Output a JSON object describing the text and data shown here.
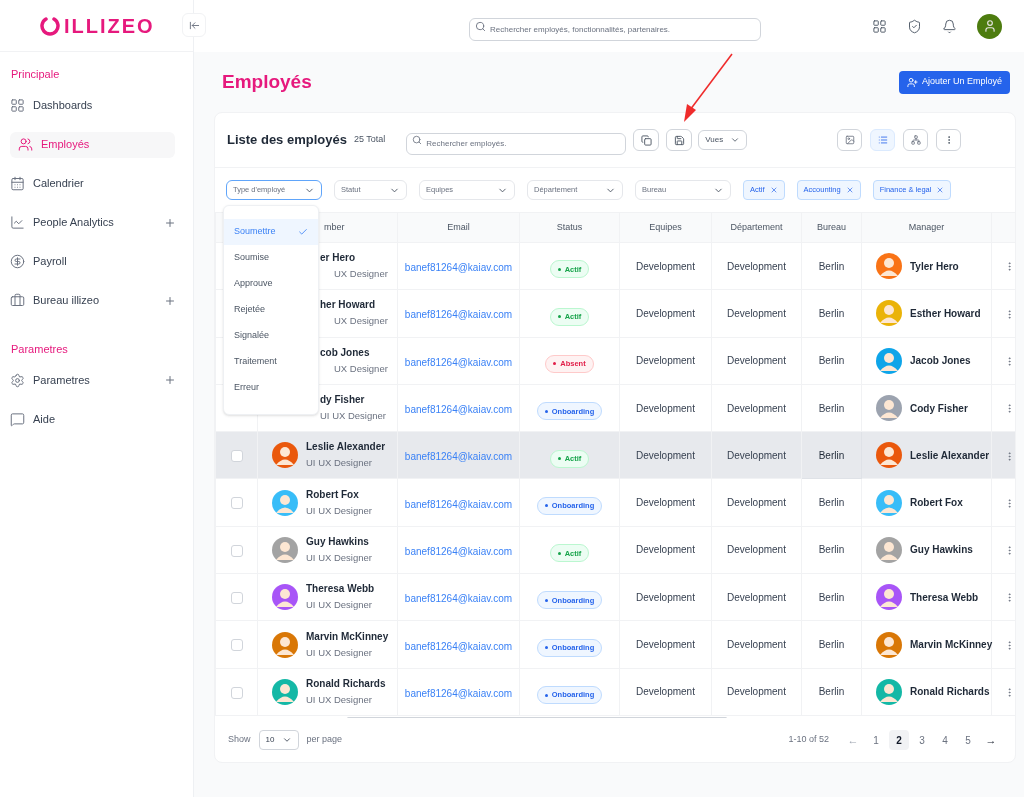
{
  "logo": "ILLIZEO",
  "search": {
    "placeholder": "Rechercher employés, fonctionnalités, partenaires."
  },
  "sidebar": {
    "sections": [
      {
        "title": "Principale",
        "items": [
          {
            "label": "Dashboards",
            "selected": false,
            "expandable": false
          },
          {
            "label": "Employés",
            "selected": true,
            "expandable": false
          },
          {
            "label": "Calendrier",
            "selected": false,
            "expandable": false
          },
          {
            "label": "People Analytics",
            "selected": false,
            "expandable": true
          },
          {
            "label": "Payroll",
            "selected": false,
            "expandable": false
          },
          {
            "label": "Bureau illizeo",
            "selected": false,
            "expandable": true
          }
        ]
      },
      {
        "title": "Parametres",
        "items": [
          {
            "label": "Parametres",
            "selected": false,
            "expandable": true
          },
          {
            "label": "Aide",
            "selected": false,
            "expandable": false
          }
        ]
      }
    ]
  },
  "page_title": "Employés",
  "add_button": "Ajouter Un Employé",
  "list": {
    "title": "Liste des employés",
    "total": "25 Total",
    "search_placeholder": "Rechercher employés.",
    "views": "Vues",
    "view_modes": [
      {
        "selected": false
      },
      {
        "selected": true
      },
      {
        "selected": false
      }
    ]
  },
  "filters": [
    {
      "placeholder": "Type d'employé",
      "open": true
    },
    {
      "placeholder": "Statut",
      "open": false
    },
    {
      "placeholder": "Equipes",
      "open": false
    },
    {
      "placeholder": "Département",
      "open": false
    },
    {
      "placeholder": "Bureau",
      "open": false
    }
  ],
  "chips": [
    "Actif",
    "Accounting",
    "Finance & legal"
  ],
  "dropdown": [
    {
      "label": "Soumettre",
      "selected": true
    },
    {
      "label": "Soumise",
      "selected": false
    },
    {
      "label": "Approuve",
      "selected": false
    },
    {
      "label": "Rejetée",
      "selected": false
    },
    {
      "label": "Signalée",
      "selected": false
    },
    {
      "label": "Traitement",
      "selected": false
    },
    {
      "label": "Erreur",
      "selected": false
    }
  ],
  "table": {
    "columns": [
      "mber",
      "Email",
      "Status",
      "Equipes",
      "Département",
      "Bureau",
      "Manager"
    ],
    "rows": [
      {
        "highlighted": false,
        "name": "er Hero",
        "role": "UX Designer",
        "email": "banef81264@kaiav.com",
        "status": "Actif",
        "kind": "active",
        "team": "Development",
        "department": "Development",
        "office": "Berlin",
        "manager": "Tyler Hero"
      },
      {
        "highlighted": false,
        "name": "her Howard",
        "role": "UX Designer",
        "email": "banef81264@kaiav.com",
        "status": "Actif",
        "kind": "active",
        "team": "Development",
        "department": "Development",
        "office": "Berlin",
        "manager": "Esther Howard"
      },
      {
        "highlighted": false,
        "name": "cob Jones",
        "role": "UX Designer",
        "email": "banef81264@kaiav.com",
        "status": "Absent",
        "kind": "absent",
        "team": "Development",
        "department": "Development",
        "office": "Berlin",
        "manager": "Jacob Jones"
      },
      {
        "highlighted": false,
        "name": "dy Fisher",
        "role": "UI UX Designer",
        "email": "banef81264@kaiav.com",
        "status": "Onboarding",
        "kind": "onboarding",
        "team": "Development",
        "department": "Development",
        "office": "Berlin",
        "manager": "Cody Fisher"
      },
      {
        "highlighted": true,
        "checked": false,
        "name": "Leslie Alexander",
        "role": "UI UX Designer",
        "email": "banef81264@kaiav.com",
        "status": "Actif",
        "kind": "active",
        "team": "Development",
        "department": "Development",
        "office": "Berlin",
        "manager": "Leslie Alexander"
      },
      {
        "highlighted": false,
        "checked": false,
        "name": "Robert Fox",
        "role": "UI UX Designer",
        "email": "banef81264@kaiav.com",
        "status": "Onboarding",
        "kind": "onboarding",
        "team": "Development",
        "department": "Development",
        "office": "Berlin",
        "manager": "Robert Fox"
      },
      {
        "highlighted": false,
        "checked": false,
        "name": "Guy Hawkins",
        "role": "UI UX Designer",
        "email": "banef81264@kaiav.com",
        "status": "Actif",
        "kind": "active",
        "team": "Development",
        "department": "Development",
        "office": "Berlin",
        "manager": "Guy Hawkins"
      },
      {
        "highlighted": false,
        "checked": false,
        "name": "Theresa Webb",
        "role": "UI UX Designer",
        "email": "banef81264@kaiav.com",
        "status": "Onboarding",
        "kind": "onboarding",
        "team": "Development",
        "department": "Development",
        "office": "Berlin",
        "manager": "Theresa Webb"
      },
      {
        "highlighted": false,
        "checked": false,
        "name": "Marvin McKinney",
        "role": "UI UX Designer",
        "email": "banef81264@kaiav.com",
        "status": "Onboarding",
        "kind": "onboarding",
        "team": "Development",
        "department": "Development",
        "office": "Berlin",
        "manager": "Marvin McKinney"
      },
      {
        "highlighted": false,
        "checked": false,
        "name": "Ronald Richards",
        "role": "UI UX Designer",
        "email": "banef81264@kaiav.com",
        "status": "Onboarding",
        "kind": "onboarding",
        "team": "Development",
        "department": "Development",
        "office": "Berlin",
        "manager": "Ronald Richards"
      }
    ]
  },
  "footer": {
    "show": "Show",
    "page_size": "10",
    "per_page": "per page",
    "range": "1-10 of 52",
    "prev": "←",
    "next": "→",
    "pages": [
      {
        "label": "1",
        "selected": false
      },
      {
        "label": "2",
        "selected": true
      },
      {
        "label": "3",
        "selected": false
      },
      {
        "label": "4",
        "selected": false
      },
      {
        "label": "5",
        "selected": false
      }
    ]
  }
}
